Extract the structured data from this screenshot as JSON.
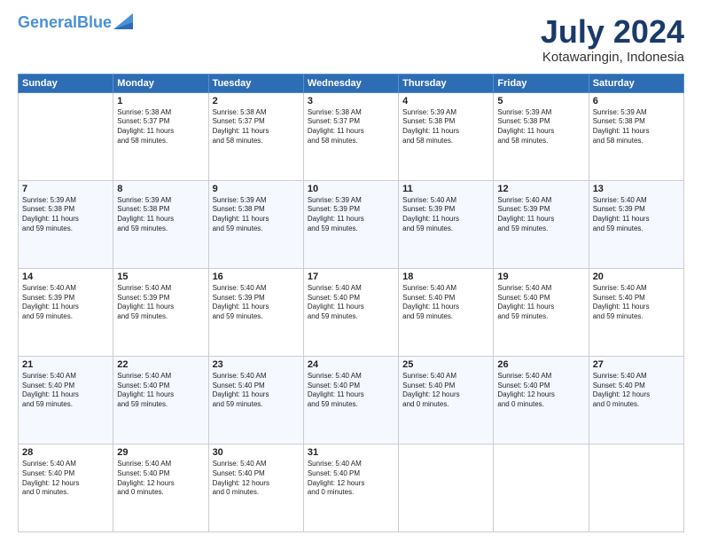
{
  "header": {
    "logo_line1": "General",
    "logo_line2": "Blue",
    "month_year": "July 2024",
    "location": "Kotawaringin, Indonesia"
  },
  "days_of_week": [
    "Sunday",
    "Monday",
    "Tuesday",
    "Wednesday",
    "Thursday",
    "Friday",
    "Saturday"
  ],
  "weeks": [
    [
      {
        "day": "",
        "info": ""
      },
      {
        "day": "1",
        "info": "Sunrise: 5:38 AM\nSunset: 5:37 PM\nDaylight: 11 hours\nand 58 minutes."
      },
      {
        "day": "2",
        "info": "Sunrise: 5:38 AM\nSunset: 5:37 PM\nDaylight: 11 hours\nand 58 minutes."
      },
      {
        "day": "3",
        "info": "Sunrise: 5:38 AM\nSunset: 5:37 PM\nDaylight: 11 hours\nand 58 minutes."
      },
      {
        "day": "4",
        "info": "Sunrise: 5:39 AM\nSunset: 5:38 PM\nDaylight: 11 hours\nand 58 minutes."
      },
      {
        "day": "5",
        "info": "Sunrise: 5:39 AM\nSunset: 5:38 PM\nDaylight: 11 hours\nand 58 minutes."
      },
      {
        "day": "6",
        "info": "Sunrise: 5:39 AM\nSunset: 5:38 PM\nDaylight: 11 hours\nand 58 minutes."
      }
    ],
    [
      {
        "day": "7",
        "info": "Sunrise: 5:39 AM\nSunset: 5:38 PM\nDaylight: 11 hours\nand 59 minutes."
      },
      {
        "day": "8",
        "info": "Sunrise: 5:39 AM\nSunset: 5:38 PM\nDaylight: 11 hours\nand 59 minutes."
      },
      {
        "day": "9",
        "info": "Sunrise: 5:39 AM\nSunset: 5:38 PM\nDaylight: 11 hours\nand 59 minutes."
      },
      {
        "day": "10",
        "info": "Sunrise: 5:39 AM\nSunset: 5:39 PM\nDaylight: 11 hours\nand 59 minutes."
      },
      {
        "day": "11",
        "info": "Sunrise: 5:40 AM\nSunset: 5:39 PM\nDaylight: 11 hours\nand 59 minutes."
      },
      {
        "day": "12",
        "info": "Sunrise: 5:40 AM\nSunset: 5:39 PM\nDaylight: 11 hours\nand 59 minutes."
      },
      {
        "day": "13",
        "info": "Sunrise: 5:40 AM\nSunset: 5:39 PM\nDaylight: 11 hours\nand 59 minutes."
      }
    ],
    [
      {
        "day": "14",
        "info": "Sunrise: 5:40 AM\nSunset: 5:39 PM\nDaylight: 11 hours\nand 59 minutes."
      },
      {
        "day": "15",
        "info": "Sunrise: 5:40 AM\nSunset: 5:39 PM\nDaylight: 11 hours\nand 59 minutes."
      },
      {
        "day": "16",
        "info": "Sunrise: 5:40 AM\nSunset: 5:39 PM\nDaylight: 11 hours\nand 59 minutes."
      },
      {
        "day": "17",
        "info": "Sunrise: 5:40 AM\nSunset: 5:40 PM\nDaylight: 11 hours\nand 59 minutes."
      },
      {
        "day": "18",
        "info": "Sunrise: 5:40 AM\nSunset: 5:40 PM\nDaylight: 11 hours\nand 59 minutes."
      },
      {
        "day": "19",
        "info": "Sunrise: 5:40 AM\nSunset: 5:40 PM\nDaylight: 11 hours\nand 59 minutes."
      },
      {
        "day": "20",
        "info": "Sunrise: 5:40 AM\nSunset: 5:40 PM\nDaylight: 11 hours\nand 59 minutes."
      }
    ],
    [
      {
        "day": "21",
        "info": "Sunrise: 5:40 AM\nSunset: 5:40 PM\nDaylight: 11 hours\nand 59 minutes."
      },
      {
        "day": "22",
        "info": "Sunrise: 5:40 AM\nSunset: 5:40 PM\nDaylight: 11 hours\nand 59 minutes."
      },
      {
        "day": "23",
        "info": "Sunrise: 5:40 AM\nSunset: 5:40 PM\nDaylight: 11 hours\nand 59 minutes."
      },
      {
        "day": "24",
        "info": "Sunrise: 5:40 AM\nSunset: 5:40 PM\nDaylight: 11 hours\nand 59 minutes."
      },
      {
        "day": "25",
        "info": "Sunrise: 5:40 AM\nSunset: 5:40 PM\nDaylight: 12 hours\nand 0 minutes."
      },
      {
        "day": "26",
        "info": "Sunrise: 5:40 AM\nSunset: 5:40 PM\nDaylight: 12 hours\nand 0 minutes."
      },
      {
        "day": "27",
        "info": "Sunrise: 5:40 AM\nSunset: 5:40 PM\nDaylight: 12 hours\nand 0 minutes."
      }
    ],
    [
      {
        "day": "28",
        "info": "Sunrise: 5:40 AM\nSunset: 5:40 PM\nDaylight: 12 hours\nand 0 minutes."
      },
      {
        "day": "29",
        "info": "Sunrise: 5:40 AM\nSunset: 5:40 PM\nDaylight: 12 hours\nand 0 minutes."
      },
      {
        "day": "30",
        "info": "Sunrise: 5:40 AM\nSunset: 5:40 PM\nDaylight: 12 hours\nand 0 minutes."
      },
      {
        "day": "31",
        "info": "Sunrise: 5:40 AM\nSunset: 5:40 PM\nDaylight: 12 hours\nand 0 minutes."
      },
      {
        "day": "",
        "info": ""
      },
      {
        "day": "",
        "info": ""
      },
      {
        "day": "",
        "info": ""
      }
    ]
  ]
}
